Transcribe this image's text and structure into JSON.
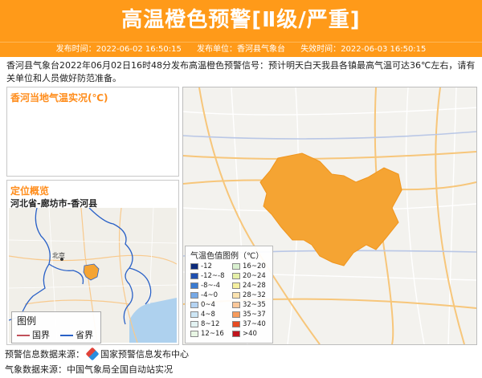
{
  "header": {
    "title": "高温橙色预警[Ⅱ级/严重]",
    "publish_time_label": "发布时间：",
    "publish_time": "2022-06-02 16:50:15",
    "publisher_label": "发布单位：",
    "publisher": "香河县气象台",
    "expire_time_label": "失效时间：",
    "expire_time": "2022-06-03 16:50:15"
  },
  "description": "香河县气象台2022年06月02日16时48分发布高温橙色预警信号：预计明天白天我县各镇最高气温可达36℃左右，请有关单位和人员做好防范准备。",
  "temp_panel": {
    "title": "香河当地气温实况(℃)"
  },
  "location_panel": {
    "title": "定位概览",
    "path": "河北省-廊坊市-香河县",
    "map_label_beijing": "北京",
    "legend_title": "图例",
    "legend_country": "国界",
    "legend_province": "省界"
  },
  "temperature_legend": {
    "title": "气温色值图例（℃）",
    "items": [
      {
        "label": "-12",
        "color": "#0b2a7a"
      },
      {
        "label": "16~20",
        "color": "#d9f0d0"
      },
      {
        "label": "-12~-8",
        "color": "#1f4fb0"
      },
      {
        "label": "20~24",
        "color": "#e6f0a8"
      },
      {
        "label": "-8~-4",
        "color": "#3b7bd1"
      },
      {
        "label": "24~28",
        "color": "#f5f0a0"
      },
      {
        "label": "-4~0",
        "color": "#77a9e6"
      },
      {
        "label": "28~32",
        "color": "#fbe3b0"
      },
      {
        "label": "0~4",
        "color": "#b4d3f2"
      },
      {
        "label": "32~35",
        "color": "#fcc89a"
      },
      {
        "label": "4~8",
        "color": "#cde6f5"
      },
      {
        "label": "35~37",
        "color": "#f79b5c"
      },
      {
        "label": "8~12",
        "color": "#e2f2f2"
      },
      {
        "label": "37~40",
        "color": "#e74c24"
      },
      {
        "label": "12~16",
        "color": "#e8f6e4"
      },
      {
        "label": ">40",
        "color": "#c0141c"
      }
    ]
  },
  "warning_region_color": "#f5a433",
  "footer": {
    "warning_source_label": "预警信息数据来源：",
    "warning_source": "国家预警信息发布中心",
    "weather_source_label": "气象数据来源：",
    "weather_source": "中国气象局全国自动站实况"
  }
}
